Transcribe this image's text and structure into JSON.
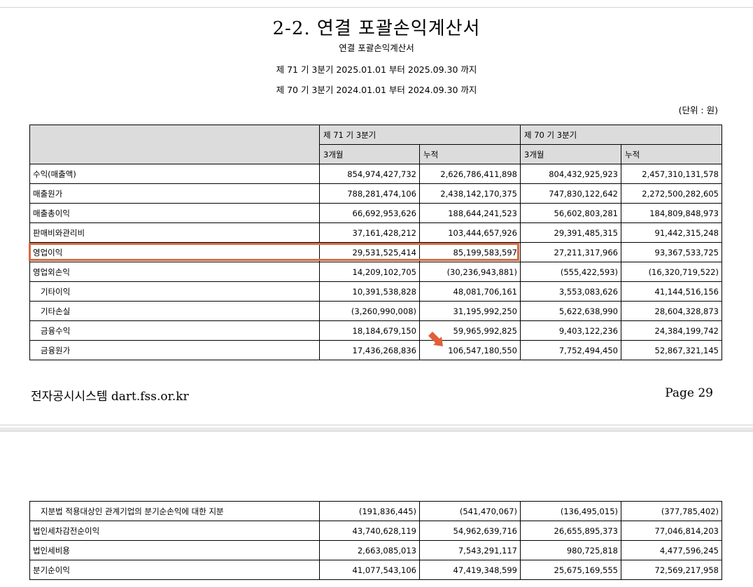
{
  "title": "2-2. 연결 포괄손익계산서",
  "subtitle": "연결 포괄손익계산서",
  "period1": "제 71 기 3분기 2025.01.01 부터 2025.09.30 까지",
  "period2": "제 70 기 3분기 2024.01.01 부터 2024.09.30 까지",
  "unit": "(단위 : 원)",
  "header": {
    "p71": "제 71 기 3분기",
    "p70": "제 70 기 3분기",
    "three_month": "3개월",
    "cumulative": "누적"
  },
  "rows": [
    {
      "label": "수익(매출액)",
      "v": [
        "854,974,427,732",
        "2,626,786,411,898",
        "804,432,925,923",
        "2,457,310,131,578"
      ]
    },
    {
      "label": "매출원가",
      "v": [
        "788,281,474,106",
        "2,438,142,170,375",
        "747,830,122,642",
        "2,272,500,282,605"
      ]
    },
    {
      "label": "매출총이익",
      "v": [
        "66,692,953,626",
        "188,644,241,523",
        "56,602,803,281",
        "184,809,848,973"
      ]
    },
    {
      "label": "판매비와관리비",
      "v": [
        "37,161,428,212",
        "103,444,657,926",
        "29,391,485,315",
        "91,442,315,248"
      ]
    },
    {
      "label": "영업이익",
      "v": [
        "29,531,525,414",
        "85,199,583,597",
        "27,211,317,966",
        "93,367,533,725"
      ]
    },
    {
      "label": "영업외손익",
      "v": [
        "14,209,102,705",
        "(30,236,943,881)",
        "(555,422,593)",
        "(16,320,719,522)"
      ]
    },
    {
      "label": "기타이익",
      "v": [
        "10,391,538,828",
        "48,081,706,161",
        "3,553,083,626",
        "41,144,516,156"
      ]
    },
    {
      "label": "기타손실",
      "v": [
        "(3,260,990,008)",
        "31,195,992,250",
        "5,622,638,990",
        "28,604,328,873"
      ]
    },
    {
      "label": "금융수익",
      "v": [
        "18,184,679,150",
        "59,965,992,825",
        "9,403,122,236",
        "24,384,199,742"
      ]
    },
    {
      "label": "금융원가",
      "v": [
        "17,436,268,836",
        "106,547,180,550",
        "7,752,494,450",
        "52,867,321,145"
      ]
    }
  ],
  "rows2": [
    {
      "label": "지분법 적용대상인 관계기업의 분기순손익에 대한 지분",
      "v": [
        "(191,836,445)",
        "(541,470,067)",
        "(136,495,015)",
        "(377,785,402)"
      ]
    },
    {
      "label": "법인세차감전순이익",
      "v": [
        "43,740,628,119",
        "54,962,639,716",
        "26,655,895,373",
        "77,046,814,203"
      ]
    },
    {
      "label": "법인세비용",
      "v": [
        "2,663,085,013",
        "7,543,291,117",
        "980,725,818",
        "4,477,596,245"
      ]
    },
    {
      "label": "분기순이익",
      "v": [
        "41,077,543,106",
        "47,419,348,599",
        "25,675,169,555",
        "72,569,217,958"
      ]
    }
  ],
  "footer": {
    "left": "전자공시시스템 dart.fss.or.kr",
    "right": "Page 29"
  },
  "colors": {
    "highlight_border": "#d86a43",
    "arrow": "#e0603a",
    "header_bg": "#dcdcdc"
  }
}
